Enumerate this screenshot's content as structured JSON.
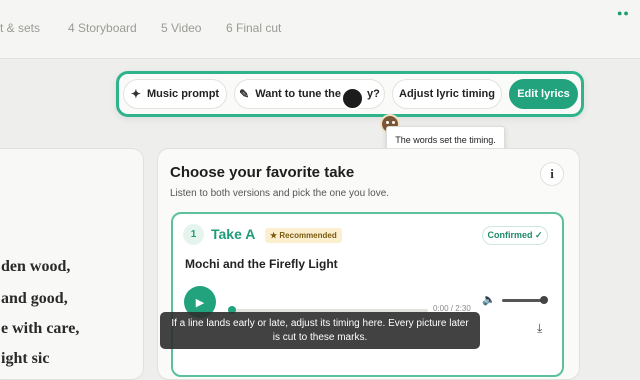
{
  "steps": [
    {
      "label": "st & sets"
    },
    {
      "label": "4 Storyboard"
    },
    {
      "label": "5 Video"
    },
    {
      "label": "6 Final cut"
    }
  ],
  "toolbar": {
    "music_prompt": {
      "label": "Music prompt",
      "icon": "sparkle-icon"
    },
    "tune": {
      "label_left": "Want to tune the",
      "label_right": "y?",
      "icon": "pencil-icon"
    },
    "adjust_timing": {
      "label": "Adjust lyric timing"
    },
    "edit_lyrics": {
      "label": "Edit lyrics"
    }
  },
  "tooltip": {
    "text": "The words set the timing."
  },
  "lyrics": {
    "lines": [
      "den wood,",
      "and good,",
      "e with care,",
      "ight sic"
    ]
  },
  "take_panel": {
    "title": "Choose your favorite take",
    "subtitle": "Listen to both versions and pick the one you love.",
    "info_label": "i",
    "take": {
      "number": "1",
      "name": "Take A",
      "recommended_badge": "★ Recommended",
      "confirmed_badge": "Confirmed ✓",
      "song_title": "Mochi and the Firefly Light",
      "time": "0:00 / 2:30",
      "progress": 0.0,
      "volume": 1.0
    }
  },
  "caption": {
    "text": "If a line lands early or late, adjust its timing here. Every picture later is cut to these marks."
  },
  "colors": {
    "accent": "#22a37d",
    "accent_border": "#2fb38a",
    "badge_bg": "#fbefcf"
  }
}
